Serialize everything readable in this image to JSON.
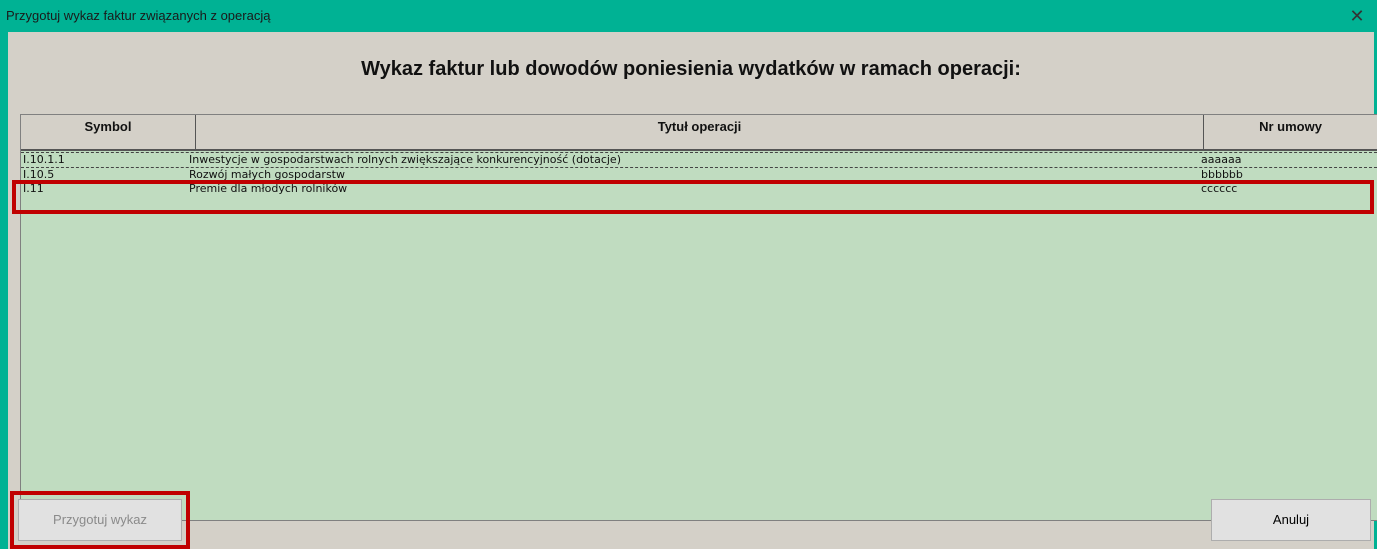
{
  "window": {
    "title": "Przygotuj wykaz faktur związanych z operacją",
    "close_glyph": "✕"
  },
  "heading": "Wykaz faktur lub dowodów poniesienia wydatków w ramach operacji:",
  "table": {
    "columns": [
      "Symbol",
      "Tytuł operacji",
      "Nr umowy"
    ],
    "rows": [
      {
        "symbol": "I.10.1.1",
        "title": "Inwestycje w gospodarstwach rolnych zwiększające konkurencyjność (dotacje)",
        "nr": "aaaaaa",
        "selected": true
      },
      {
        "symbol": "I.10.5",
        "title": "Rozwój małych gospodarstw",
        "nr": "bbbbbb",
        "selected": false
      },
      {
        "symbol": "I.11",
        "title": "Premie dla młodych rolników",
        "nr": "cccccc",
        "selected": false,
        "highlighted": true
      }
    ]
  },
  "buttons": {
    "prepare": "Przygotuj wykaz",
    "prepare_enabled": false,
    "cancel": "Anuluj"
  },
  "colors": {
    "titlebar": "#00b294",
    "list_background": "#c0dcc0",
    "highlight": "#c00000"
  }
}
